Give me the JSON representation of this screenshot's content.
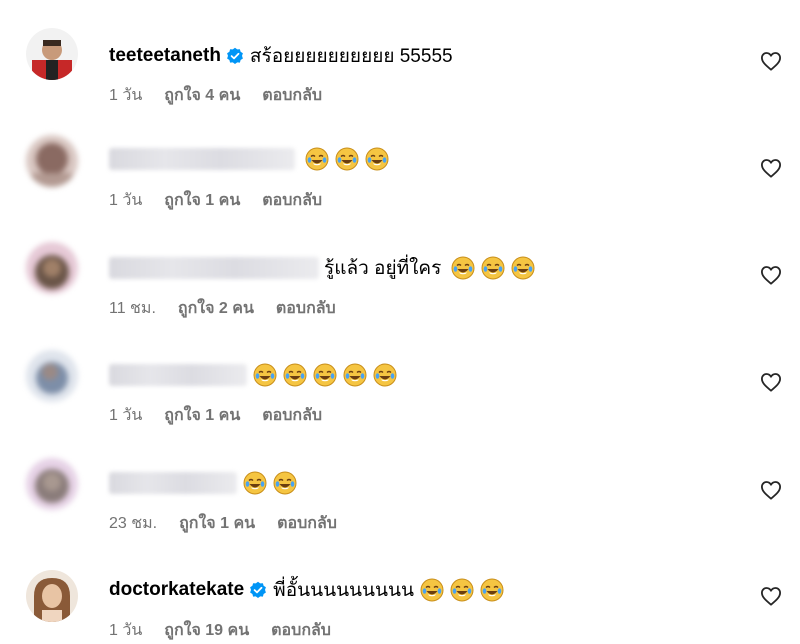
{
  "comments": [
    {
      "username": "teeteetaneth",
      "verified": true,
      "text": "สร้อยยยยยยยยยย 55555",
      "emoji_count": 0,
      "time": "1 วัน",
      "likes": "ถูกใจ 4 คน",
      "reply": "ตอบกลับ",
      "avatar_color": "#c62828"
    },
    {
      "username": "",
      "verified": false,
      "text": "",
      "emoji_count": 3,
      "time": "1 วัน",
      "likes": "ถูกใจ 1 คน",
      "reply": "ตอบกลับ",
      "avatar_color": "#8a6a62"
    },
    {
      "username": "",
      "verified": false,
      "text": "รู้แล้ว อยู่ที่ใคร",
      "emoji_count": 3,
      "time": "11 ชม.",
      "likes": "ถูกใจ 2 คน",
      "reply": "ตอบกลับ",
      "avatar_color": "#6a5548"
    },
    {
      "username": "",
      "verified": false,
      "text": "",
      "emoji_count": 5,
      "time": "1 วัน",
      "likes": "ถูกใจ 1 คน",
      "reply": "ตอบกลับ",
      "avatar_color": "#7d8ea8"
    },
    {
      "username": "",
      "verified": false,
      "text": "",
      "emoji_count": 2,
      "time": "23 ชม.",
      "likes": "ถูกใจ 1 คน",
      "reply": "ตอบกลับ",
      "avatar_color": "#8a7c7a"
    },
    {
      "username": "doctorkatekate",
      "verified": true,
      "text": "พี่อั้นนนนนนนนน",
      "emoji_count": 3,
      "time": "1 วัน",
      "likes": "ถูกใจ 19 คน",
      "reply": "ตอบกลับ",
      "avatar_color": "#c8a07a"
    }
  ],
  "icons": {
    "verified": "verified-badge-icon",
    "emoji": "face-with-tears-of-joy-icon",
    "like": "heart-outline-icon"
  },
  "colors": {
    "verified_blue": "#0095f6",
    "meta_gray": "#737373",
    "emoji_yellow": "#f5c542"
  }
}
